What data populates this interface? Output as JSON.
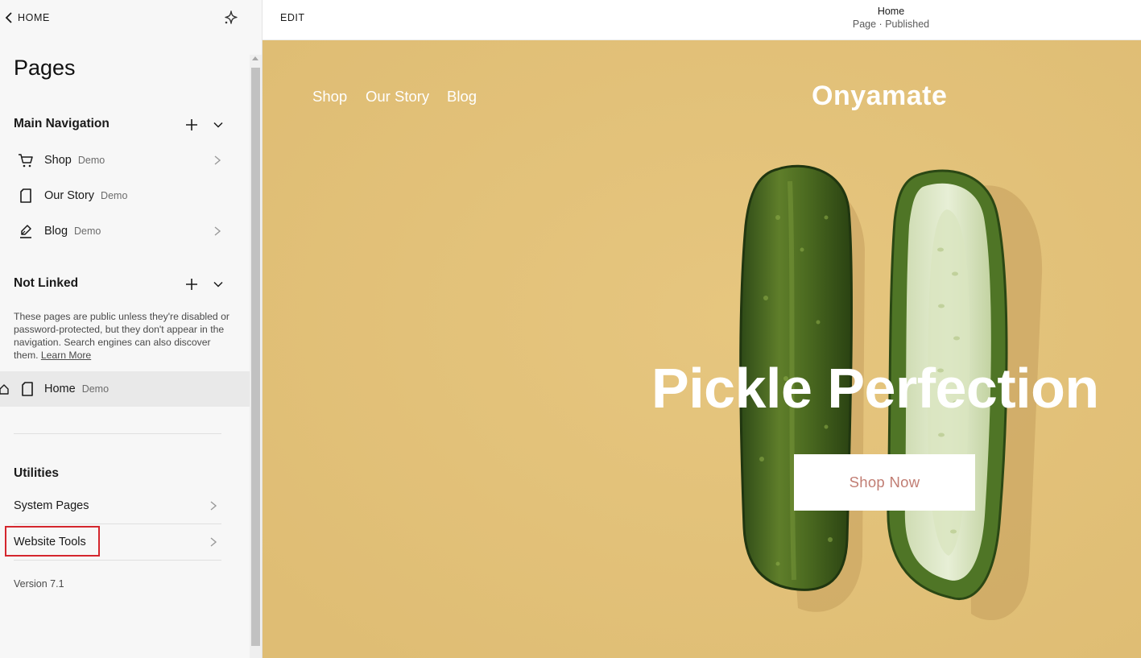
{
  "sidebar": {
    "back_label": "HOME",
    "title": "Pages",
    "main_navigation": {
      "heading": "Main Navigation",
      "items": [
        {
          "label": "Shop",
          "tag": "Demo",
          "icon": "cart-icon"
        },
        {
          "label": "Our Story",
          "tag": "Demo",
          "icon": "page-icon"
        },
        {
          "label": "Blog",
          "tag": "Demo",
          "icon": "blog-edit-icon"
        }
      ]
    },
    "not_linked": {
      "heading": "Not Linked",
      "note": "These pages are public unless they're disabled or password-protected, but they don't appear in the navigation. Search engines can also discover them.",
      "learn_more": "Learn More",
      "items": [
        {
          "label": "Home",
          "tag": "Demo",
          "icon": "page-icon"
        }
      ]
    },
    "utilities": {
      "heading": "Utilities",
      "items": [
        {
          "label": "System Pages"
        },
        {
          "label": "Website Tools"
        }
      ]
    },
    "version": "Version 7.1"
  },
  "topbar": {
    "edit_label": "EDIT",
    "page_name": "Home",
    "page_status": "Page · Published"
  },
  "preview": {
    "nav": [
      "Shop",
      "Our Story",
      "Blog"
    ],
    "logo": "Onyamate",
    "headline": "Pickle Perfection",
    "cta": "Shop Now"
  },
  "colors": {
    "hero_background": "#e2c178",
    "cta_text": "#c17d73",
    "highlight": "#d4262d"
  }
}
